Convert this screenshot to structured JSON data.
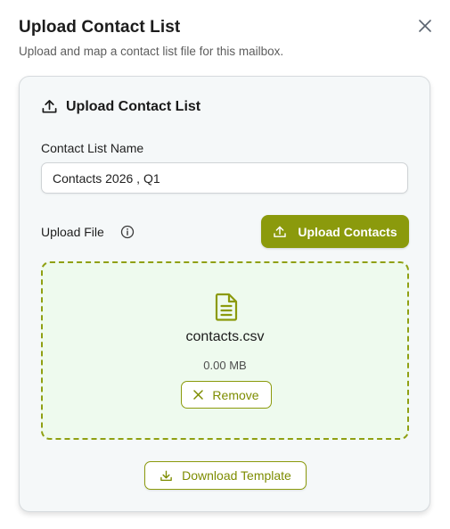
{
  "dialog": {
    "title": "Upload Contact List",
    "subtitle": "Upload and map a contact list file for this mailbox."
  },
  "card": {
    "title": "Upload Contact List",
    "name_label": "Contact List Name",
    "name_value": "Contacts 2026 , Q1",
    "upload_label": "Upload File",
    "upload_button": "Upload Contacts",
    "download_button": "Download Template"
  },
  "file": {
    "name": "contacts.csv",
    "size": "0.00 MB",
    "remove_label": "Remove"
  },
  "icons": {
    "close": "close-icon",
    "upload": "upload-icon",
    "info": "info-icon",
    "file": "file-text-icon",
    "remove": "x-icon",
    "download": "download-icon"
  },
  "colors": {
    "accent": "#8b9a0c",
    "accent_text": "#7d8c00",
    "dropzone_bg": "#eefaee",
    "card_bg": "#f5f8f9"
  }
}
